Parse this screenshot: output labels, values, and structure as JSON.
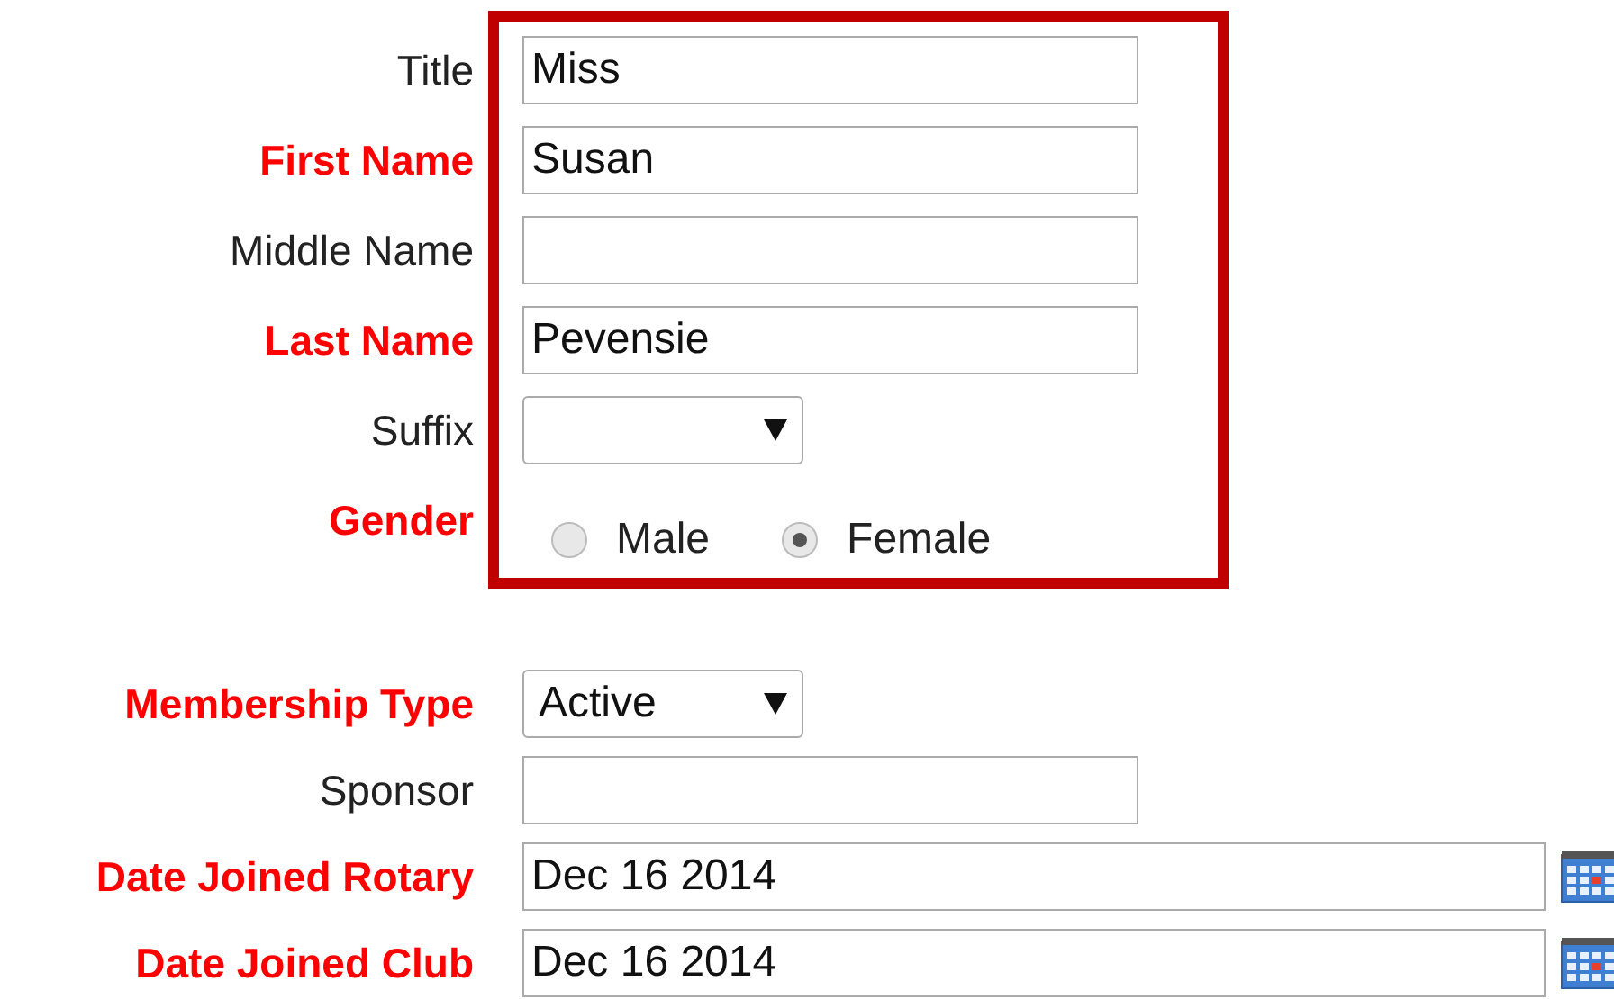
{
  "sections": [
    {
      "highlighted": true,
      "fields": [
        {
          "label": "Title",
          "required": false,
          "kind": "text",
          "value": "Miss"
        },
        {
          "label": "First Name",
          "required": true,
          "kind": "text",
          "value": "Susan"
        },
        {
          "label": "Middle Name",
          "required": false,
          "kind": "text"
        },
        {
          "label": "Last Name",
          "required": true,
          "kind": "text",
          "value": "Pevensie"
        },
        {
          "label": "Suffix",
          "required": false,
          "kind": "select"
        },
        {
          "label": "Gender",
          "required": true,
          "kind": "radio",
          "options": [
            {
              "label": "Male",
              "selected": false
            },
            {
              "label": "Female",
              "selected": true
            }
          ]
        }
      ]
    },
    {
      "highlighted": false,
      "fields": [
        {
          "label": "Membership Type",
          "required": true,
          "kind": "select",
          "value": "Active"
        },
        {
          "label": "Sponsor",
          "required": false,
          "kind": "text"
        },
        {
          "label": "Date Joined Rotary",
          "required": true,
          "kind": "date",
          "value": "Dec 16 2014"
        },
        {
          "label": "Date Joined Club",
          "required": true,
          "kind": "date",
          "value": "Dec 16 2014"
        }
      ]
    }
  ]
}
